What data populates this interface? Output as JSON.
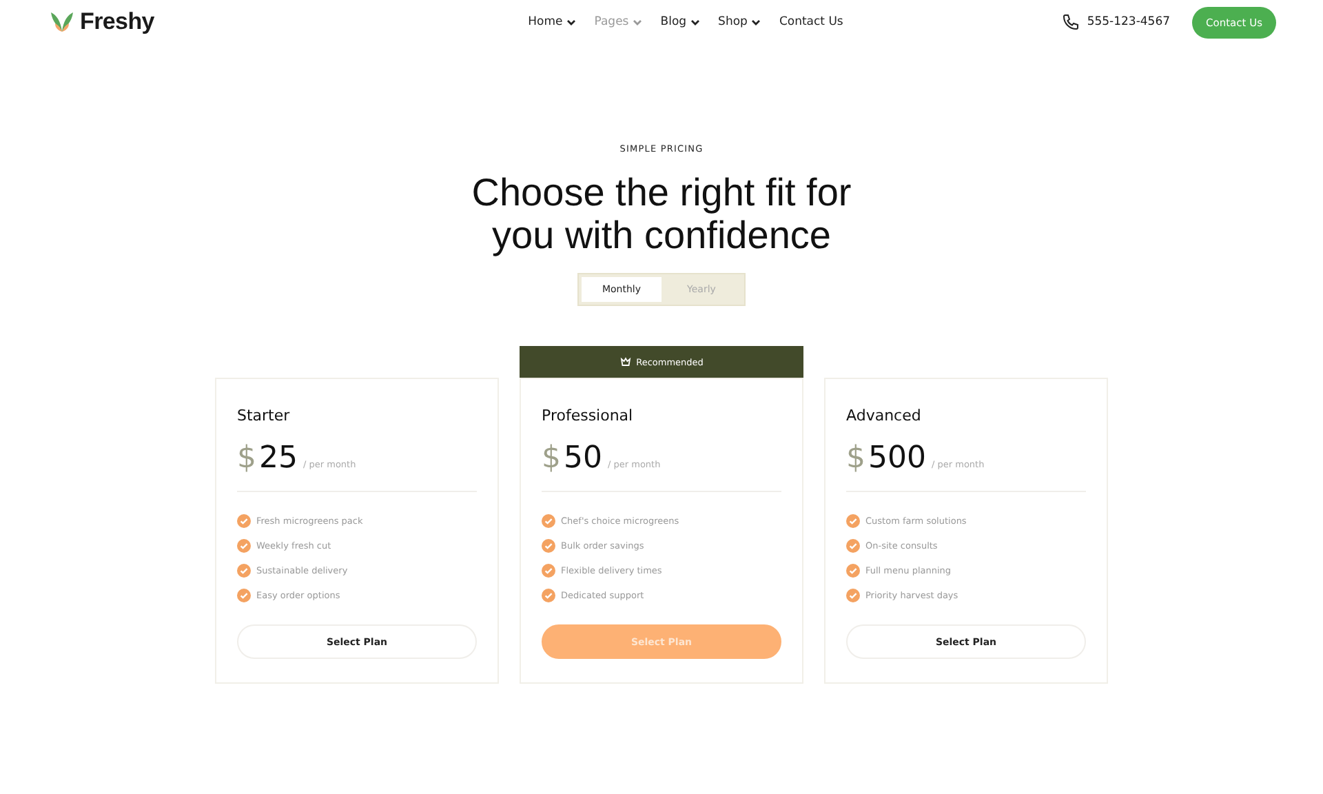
{
  "header": {
    "brand": "Freshy",
    "nav": [
      {
        "label": "Home",
        "dropdown": true,
        "selected": false
      },
      {
        "label": "Pages",
        "dropdown": true,
        "selected": true
      },
      {
        "label": "Blog",
        "dropdown": true,
        "selected": false
      },
      {
        "label": "Shop",
        "dropdown": true,
        "selected": false
      },
      {
        "label": "Contact Us",
        "dropdown": false,
        "selected": false
      }
    ],
    "phone": "555-123-4567",
    "cta": "Contact Us"
  },
  "eyebrow": "SIMPLE PRICING",
  "heading": "Choose the right fit for you with confidence",
  "billing": [
    {
      "label": "Monthly",
      "selected": true
    },
    {
      "label": "Yearly",
      "selected": false
    }
  ],
  "plans": [
    {
      "name": "Starter",
      "currency": "$",
      "price": "25",
      "period": "/ per month",
      "featured": false,
      "features": [
        "Fresh microgreens pack",
        "Weekly fresh cut",
        "Sustainable delivery",
        "Easy order options"
      ],
      "button": "Select Plan"
    },
    {
      "name": "Professional",
      "badge": "Recommended",
      "currency": "$",
      "price": "50",
      "period": "/ per month",
      "featured": true,
      "features": [
        "Chef's choice microgreens",
        "Bulk order savings",
        "Flexible delivery times",
        "Dedicated support"
      ],
      "button": "Select Plan"
    },
    {
      "name": "Advanced",
      "currency": "$",
      "price": "500",
      "period": "/ per month",
      "featured": false,
      "features": [
        "Custom farm solutions",
        "On-site consults",
        "Full menu planning",
        "Priority harvest days"
      ],
      "button": "Select Plan"
    }
  ]
}
